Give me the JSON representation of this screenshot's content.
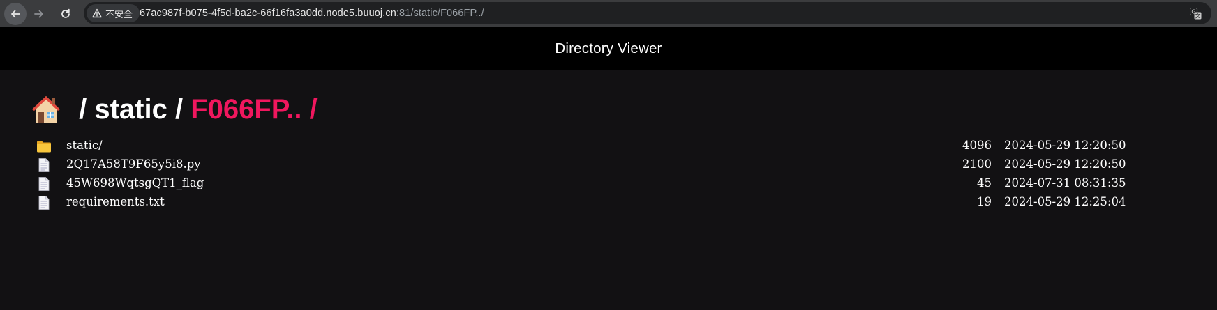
{
  "browser": {
    "security_label": "不安全",
    "url_host": "67ac987f-b075-4f5d-ba2c-66f16fa3a0dd.node5.buuoj.cn",
    "url_path": ":81/static/F066FP../",
    "icons": {
      "back": "arrow-left-icon",
      "forward": "arrow-right-icon",
      "reload": "reload-icon",
      "security": "warning-triangle-icon",
      "translate": "translate-icon"
    }
  },
  "header": {
    "title": "Directory Viewer"
  },
  "breadcrumb": {
    "home_icon": "house-emoji-icon",
    "sep1": " / ",
    "crumb1": "static",
    "sep2": " / ",
    "current": "F066FP.. /",
    "accent_color": "#f0175e"
  },
  "listing": {
    "entries": [
      {
        "icon": "folder-icon",
        "name": "static/",
        "size": "4096",
        "date": "2024-05-29 12:20:50"
      },
      {
        "icon": "file-icon",
        "name": "2Q17A58T9F65y5i8.py",
        "size": "2100",
        "date": "2024-05-29 12:20:50"
      },
      {
        "icon": "file-icon",
        "name": "45W698WqtsgQT1_flag",
        "size": "45",
        "date": "2024-07-31 08:31:35"
      },
      {
        "icon": "file-icon",
        "name": "requirements.txt",
        "size": "19",
        "date": "2024-05-29 12:25:04"
      }
    ]
  }
}
